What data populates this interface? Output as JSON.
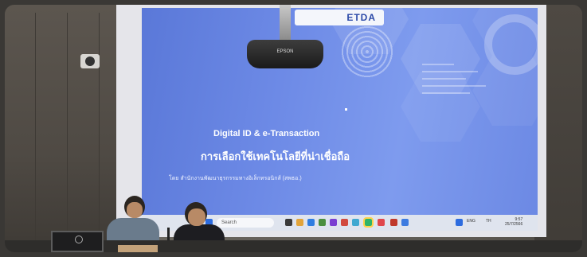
{
  "slide": {
    "brand_logo_text": "ETDA",
    "projector_brand": "EPSON",
    "title_en": "Digital ID & e-Transaction",
    "title_th": "การเลือกใช้เทคโนโลยีที่น่าเชื่อถือ",
    "byline": "โดย สำนักงานพัฒนาธุรกรรมทางอิเล็กทรอนิกส์ (สพธอ.)"
  },
  "taskbar": {
    "search_placeholder": "Search",
    "tray_lang": "ENG",
    "tray_weather": "TH",
    "clock_time": "9:57",
    "clock_date": "25/7/2566"
  },
  "colors": {
    "slide_blue": "#6d8ae6",
    "taskbar": "#dfe4ee",
    "text_white": "#ffffff"
  },
  "icons": [
    "windows-icon",
    "search-icon",
    "app-icon",
    "wifi-icon",
    "volume-icon"
  ]
}
